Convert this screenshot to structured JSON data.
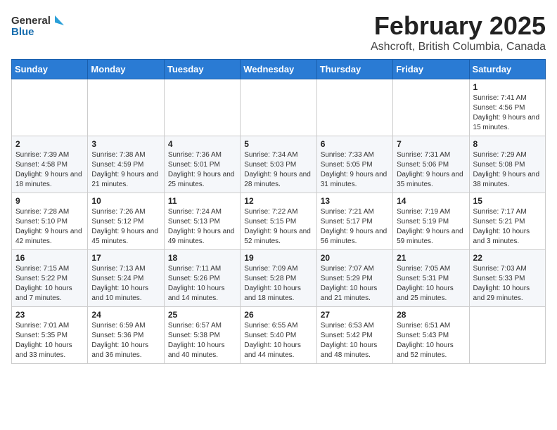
{
  "logo": {
    "text_general": "General",
    "text_blue": "Blue"
  },
  "title": {
    "month": "February 2025",
    "location": "Ashcroft, British Columbia, Canada"
  },
  "days_of_week": [
    "Sunday",
    "Monday",
    "Tuesday",
    "Wednesday",
    "Thursday",
    "Friday",
    "Saturday"
  ],
  "weeks": [
    [
      {
        "day": "",
        "info": ""
      },
      {
        "day": "",
        "info": ""
      },
      {
        "day": "",
        "info": ""
      },
      {
        "day": "",
        "info": ""
      },
      {
        "day": "",
        "info": ""
      },
      {
        "day": "",
        "info": ""
      },
      {
        "day": "1",
        "info": "Sunrise: 7:41 AM\nSunset: 4:56 PM\nDaylight: 9 hours and 15 minutes."
      }
    ],
    [
      {
        "day": "2",
        "info": "Sunrise: 7:39 AM\nSunset: 4:58 PM\nDaylight: 9 hours and 18 minutes."
      },
      {
        "day": "3",
        "info": "Sunrise: 7:38 AM\nSunset: 4:59 PM\nDaylight: 9 hours and 21 minutes."
      },
      {
        "day": "4",
        "info": "Sunrise: 7:36 AM\nSunset: 5:01 PM\nDaylight: 9 hours and 25 minutes."
      },
      {
        "day": "5",
        "info": "Sunrise: 7:34 AM\nSunset: 5:03 PM\nDaylight: 9 hours and 28 minutes."
      },
      {
        "day": "6",
        "info": "Sunrise: 7:33 AM\nSunset: 5:05 PM\nDaylight: 9 hours and 31 minutes."
      },
      {
        "day": "7",
        "info": "Sunrise: 7:31 AM\nSunset: 5:06 PM\nDaylight: 9 hours and 35 minutes."
      },
      {
        "day": "8",
        "info": "Sunrise: 7:29 AM\nSunset: 5:08 PM\nDaylight: 9 hours and 38 minutes."
      }
    ],
    [
      {
        "day": "9",
        "info": "Sunrise: 7:28 AM\nSunset: 5:10 PM\nDaylight: 9 hours and 42 minutes."
      },
      {
        "day": "10",
        "info": "Sunrise: 7:26 AM\nSunset: 5:12 PM\nDaylight: 9 hours and 45 minutes."
      },
      {
        "day": "11",
        "info": "Sunrise: 7:24 AM\nSunset: 5:13 PM\nDaylight: 9 hours and 49 minutes."
      },
      {
        "day": "12",
        "info": "Sunrise: 7:22 AM\nSunset: 5:15 PM\nDaylight: 9 hours and 52 minutes."
      },
      {
        "day": "13",
        "info": "Sunrise: 7:21 AM\nSunset: 5:17 PM\nDaylight: 9 hours and 56 minutes."
      },
      {
        "day": "14",
        "info": "Sunrise: 7:19 AM\nSunset: 5:19 PM\nDaylight: 9 hours and 59 minutes."
      },
      {
        "day": "15",
        "info": "Sunrise: 7:17 AM\nSunset: 5:21 PM\nDaylight: 10 hours and 3 minutes."
      }
    ],
    [
      {
        "day": "16",
        "info": "Sunrise: 7:15 AM\nSunset: 5:22 PM\nDaylight: 10 hours and 7 minutes."
      },
      {
        "day": "17",
        "info": "Sunrise: 7:13 AM\nSunset: 5:24 PM\nDaylight: 10 hours and 10 minutes."
      },
      {
        "day": "18",
        "info": "Sunrise: 7:11 AM\nSunset: 5:26 PM\nDaylight: 10 hours and 14 minutes."
      },
      {
        "day": "19",
        "info": "Sunrise: 7:09 AM\nSunset: 5:28 PM\nDaylight: 10 hours and 18 minutes."
      },
      {
        "day": "20",
        "info": "Sunrise: 7:07 AM\nSunset: 5:29 PM\nDaylight: 10 hours and 21 minutes."
      },
      {
        "day": "21",
        "info": "Sunrise: 7:05 AM\nSunset: 5:31 PM\nDaylight: 10 hours and 25 minutes."
      },
      {
        "day": "22",
        "info": "Sunrise: 7:03 AM\nSunset: 5:33 PM\nDaylight: 10 hours and 29 minutes."
      }
    ],
    [
      {
        "day": "23",
        "info": "Sunrise: 7:01 AM\nSunset: 5:35 PM\nDaylight: 10 hours and 33 minutes."
      },
      {
        "day": "24",
        "info": "Sunrise: 6:59 AM\nSunset: 5:36 PM\nDaylight: 10 hours and 36 minutes."
      },
      {
        "day": "25",
        "info": "Sunrise: 6:57 AM\nSunset: 5:38 PM\nDaylight: 10 hours and 40 minutes."
      },
      {
        "day": "26",
        "info": "Sunrise: 6:55 AM\nSunset: 5:40 PM\nDaylight: 10 hours and 44 minutes."
      },
      {
        "day": "27",
        "info": "Sunrise: 6:53 AM\nSunset: 5:42 PM\nDaylight: 10 hours and 48 minutes."
      },
      {
        "day": "28",
        "info": "Sunrise: 6:51 AM\nSunset: 5:43 PM\nDaylight: 10 hours and 52 minutes."
      },
      {
        "day": "",
        "info": ""
      }
    ]
  ]
}
